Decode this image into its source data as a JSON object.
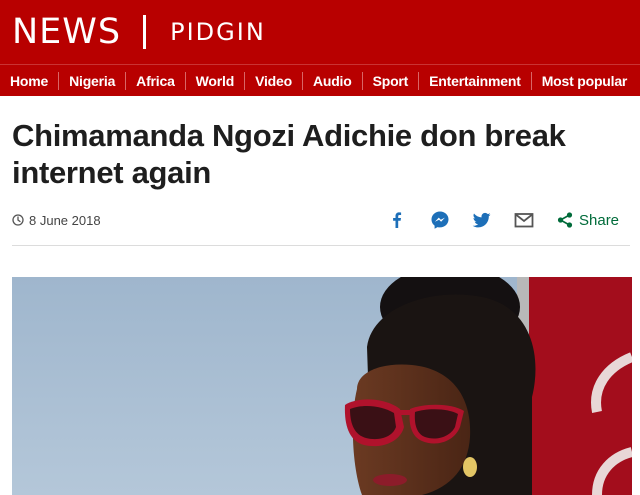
{
  "brand": {
    "news": "NEWS",
    "service": "PIDGIN"
  },
  "nav": {
    "items": [
      "Home",
      "Nigeria",
      "Africa",
      "World",
      "Video",
      "Audio",
      "Sport",
      "Entertainment",
      "Most popular"
    ]
  },
  "article": {
    "headline": "Chimamanda Ngozi Adichie don break internet again",
    "date": "8 June 2018"
  },
  "share": {
    "label": "Share",
    "icons": [
      "facebook-icon",
      "messenger-icon",
      "twitter-icon",
      "email-icon",
      "share-icon"
    ]
  },
  "colors": {
    "brand_red": "#b80000",
    "share_green": "#006b3a",
    "icon_blue": "#1d6fb8"
  }
}
